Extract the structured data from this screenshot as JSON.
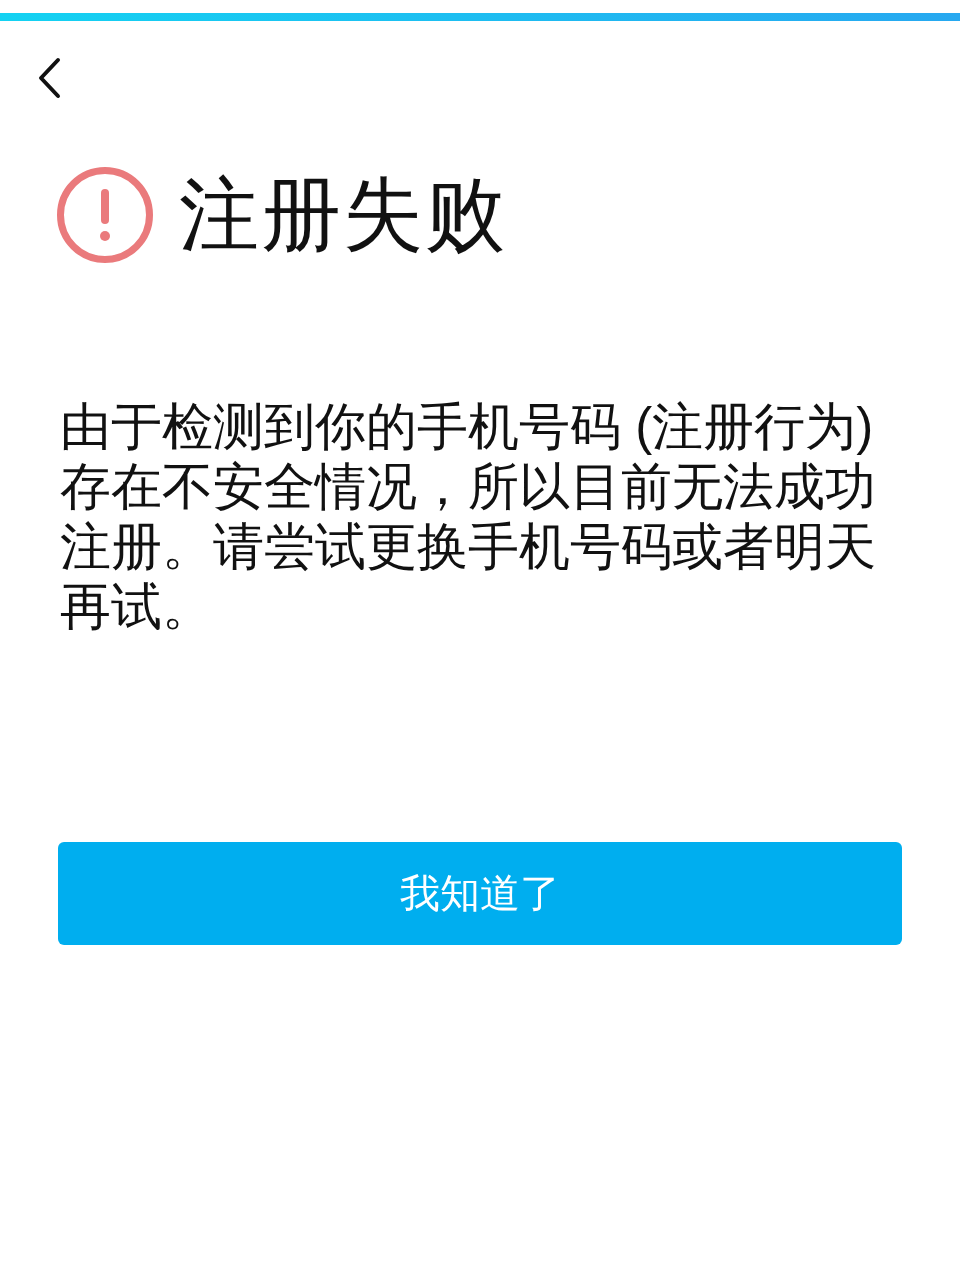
{
  "title": "注册失败",
  "message": "由于检测到你的手机号码 (注册行为)存在不安全情况，所以目前无法成功注册。请尝试更换手机号码或者明天再试。",
  "button": "我知道了"
}
